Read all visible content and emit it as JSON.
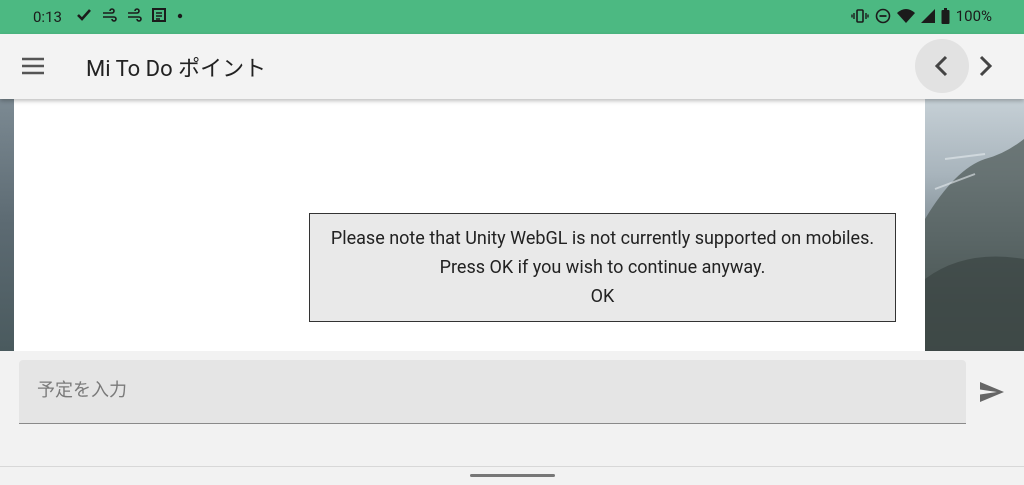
{
  "status_bar": {
    "time": "0:13",
    "battery": "100%",
    "left_icons": [
      "check-icon",
      "wind-icon",
      "wind-icon",
      "newspaper-icon",
      "dot-icon"
    ],
    "right_icons": [
      "vibrate-icon",
      "dnd-icon",
      "wifi-icon",
      "signal-icon",
      "battery-icon"
    ],
    "color": "#4cb982"
  },
  "app_bar": {
    "title": "Mi To Do ポイント",
    "menu_icon": "hamburger-icon",
    "back_icon": "chevron-left-icon",
    "forward_icon": "chevron-right-icon"
  },
  "dialog": {
    "message": "Please note that Unity WebGL is not currently supported on mobiles. Press OK if you wish to continue anyway.",
    "ok_label": "OK"
  },
  "input": {
    "placeholder": "予定を入力",
    "value": "",
    "send_icon": "send-icon"
  }
}
